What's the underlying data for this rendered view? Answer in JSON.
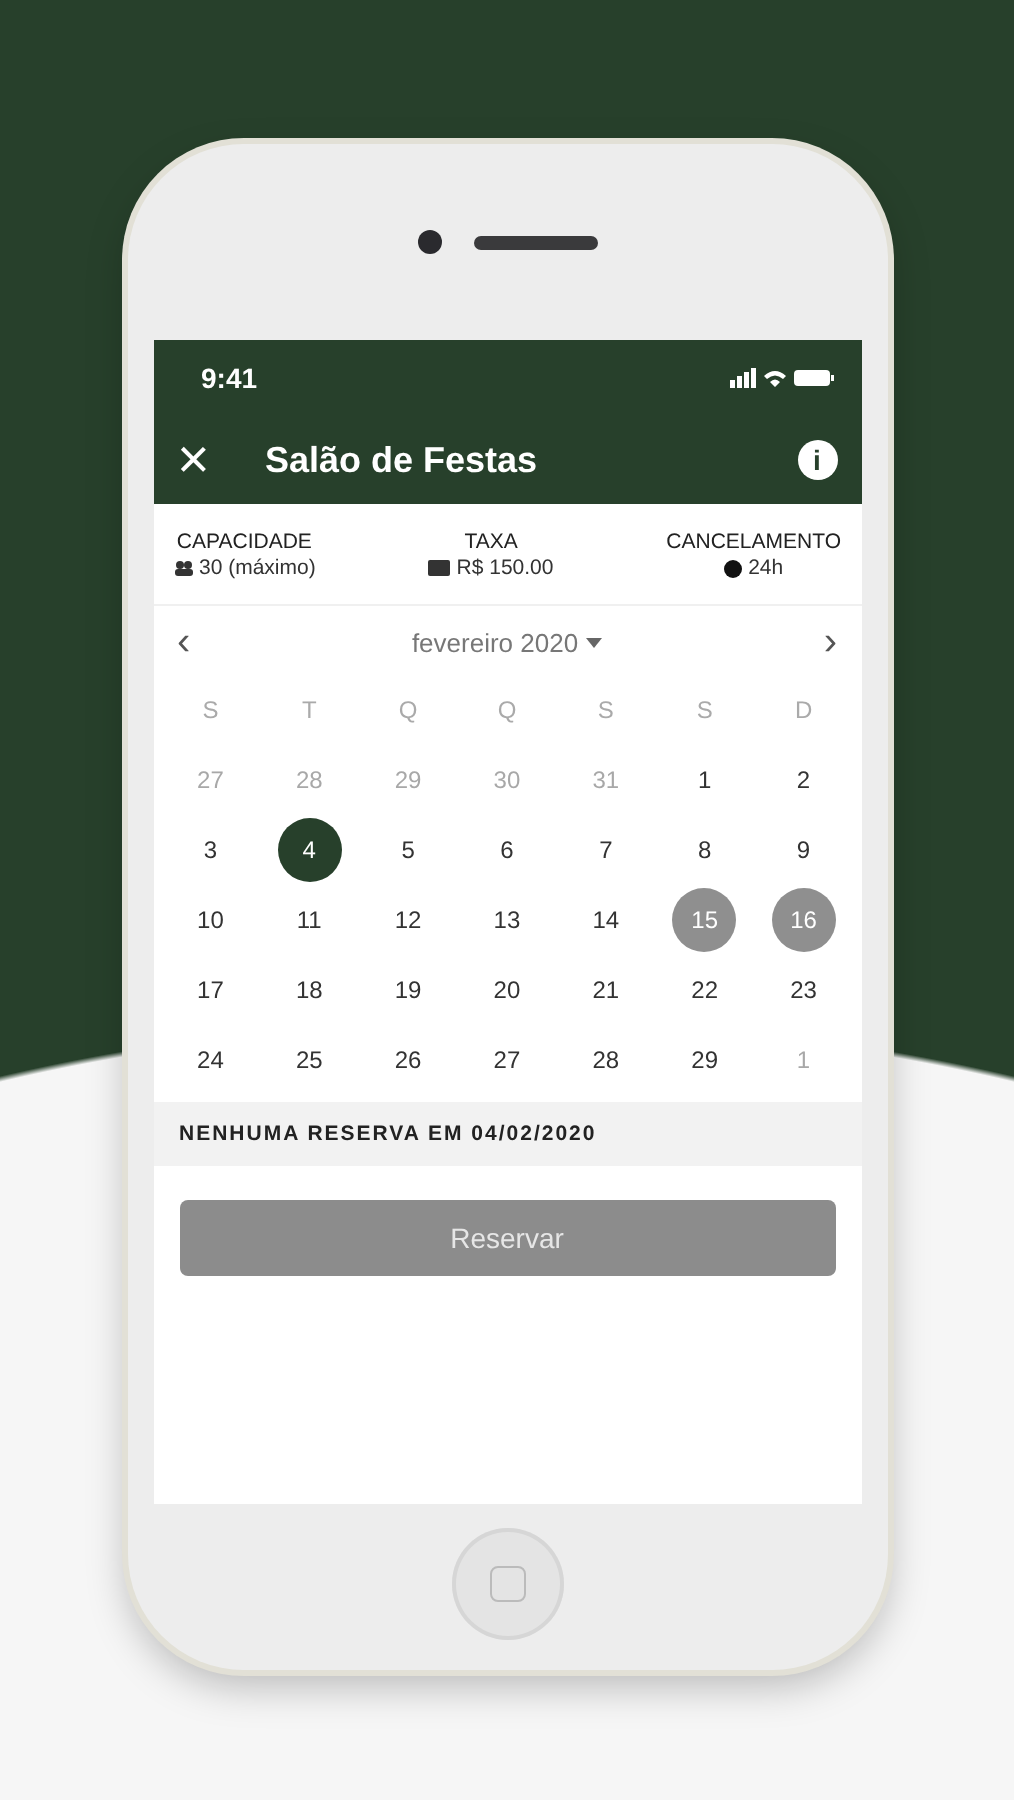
{
  "status_bar": {
    "time": "9:41"
  },
  "header": {
    "close": "×",
    "title": "Salão de Festas",
    "info": "i"
  },
  "info": [
    {
      "kind": "people",
      "label": "CAPACIDADE",
      "value": "30 (máximo)"
    },
    {
      "kind": "money",
      "label": "TAXA",
      "value": "R$ 150.00"
    },
    {
      "kind": "clock",
      "label": "CANCELAMENTO",
      "value": "24h"
    }
  ],
  "calendar": {
    "prev": "‹",
    "month": "fevereiro 2020",
    "next": "›",
    "weekdays": [
      "S",
      "T",
      "Q",
      "Q",
      "S",
      "S",
      "D"
    ],
    "days": [
      {
        "label": "27",
        "kind": "muted",
        "selected": false
      },
      {
        "label": "28",
        "kind": "muted",
        "selected": false
      },
      {
        "label": "29",
        "kind": "muted",
        "selected": false
      },
      {
        "label": "30",
        "kind": "muted",
        "selected": false
      },
      {
        "label": "31",
        "kind": "muted",
        "selected": false
      },
      {
        "label": "1",
        "kind": "normal",
        "selected": false
      },
      {
        "label": "2",
        "kind": "normal",
        "selected": false
      },
      {
        "label": "3",
        "kind": "normal",
        "selected": false
      },
      {
        "label": "4",
        "kind": "normal",
        "selected": true
      },
      {
        "label": "5",
        "kind": "normal",
        "selected": false
      },
      {
        "label": "6",
        "kind": "normal",
        "selected": false
      },
      {
        "label": "7",
        "kind": "normal",
        "selected": false
      },
      {
        "label": "8",
        "kind": "normal",
        "selected": false
      },
      {
        "label": "9",
        "kind": "normal",
        "selected": false
      },
      {
        "label": "10",
        "kind": "normal",
        "selected": false
      },
      {
        "label": "11",
        "kind": "normal",
        "selected": false
      },
      {
        "label": "12",
        "kind": "normal",
        "selected": false
      },
      {
        "label": "13",
        "kind": "normal",
        "selected": false
      },
      {
        "label": "14",
        "kind": "normal",
        "selected": false
      },
      {
        "label": "15",
        "kind": "blocked",
        "selected": false
      },
      {
        "label": "16",
        "kind": "blocked",
        "selected": false
      },
      {
        "label": "17",
        "kind": "normal",
        "selected": false
      },
      {
        "label": "18",
        "kind": "normal",
        "selected": false
      },
      {
        "label": "19",
        "kind": "normal",
        "selected": false
      },
      {
        "label": "20",
        "kind": "normal",
        "selected": false
      },
      {
        "label": "21",
        "kind": "normal",
        "selected": false
      },
      {
        "label": "22",
        "kind": "normal",
        "selected": false
      },
      {
        "label": "23",
        "kind": "normal",
        "selected": false
      },
      {
        "label": "24",
        "kind": "normal",
        "selected": false
      },
      {
        "label": "25",
        "kind": "normal",
        "selected": false
      },
      {
        "label": "26",
        "kind": "normal",
        "selected": false
      },
      {
        "label": "27",
        "kind": "normal",
        "selected": false
      },
      {
        "label": "28",
        "kind": "normal",
        "selected": false
      },
      {
        "label": "29",
        "kind": "normal",
        "selected": false
      },
      {
        "label": "1",
        "kind": "muted",
        "selected": false
      }
    ]
  },
  "notice": "NENHUMA RESERVA EM 04/02/2020",
  "reserve_button": {
    "label": "Reservar",
    "disabled": true
  }
}
